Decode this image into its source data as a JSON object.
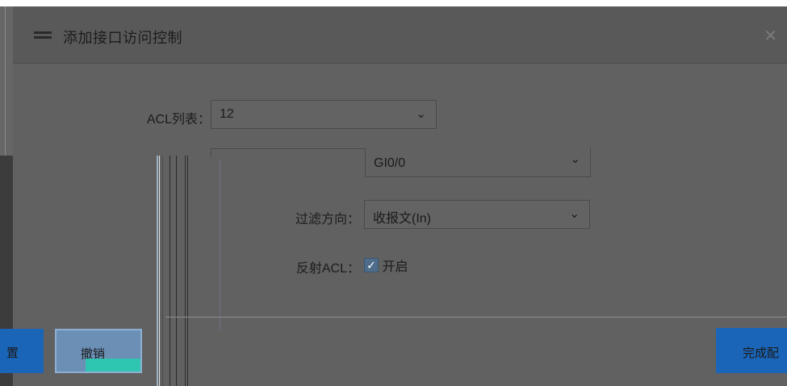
{
  "dialog": {
    "title": "添加接口访问控制",
    "close_glyph": "✕"
  },
  "form": {
    "acl_list_label": "ACL列表：",
    "acl_list_value": "12",
    "interface_label": "",
    "interface_value": "GI0/0",
    "direction_label": "过滤方向：",
    "direction_value": "收报文(In)",
    "reflect_label": "反射ACL：",
    "reflect_checked": true,
    "reflect_option": "开启"
  },
  "footer": {
    "reset_label": "置",
    "cancel_label": "撤销",
    "finish_label": "完成配"
  },
  "colors": {
    "primary_button": "#1a65b8",
    "cancel_button": "#6b8fb5",
    "cancel_accent": "#2ec6b0"
  }
}
